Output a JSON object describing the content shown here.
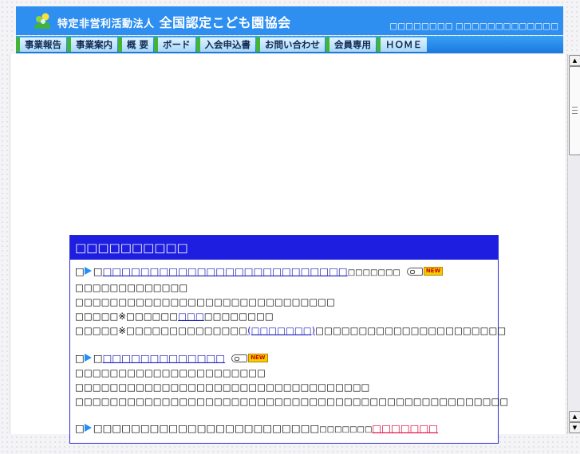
{
  "header": {
    "title_small": "特定非営利活動法人",
    "title_main": "全国認定こども園協会",
    "subtitle": "□□□□□□□□ □□□□□□□□□□□□□"
  },
  "nav": [
    {
      "label": "事業報告"
    },
    {
      "label": "事業案内"
    },
    {
      "label": "概 要"
    },
    {
      "label": "ボード"
    },
    {
      "label": "入会申込書"
    },
    {
      "label": "お問い合わせ"
    },
    {
      "label": "会員専用"
    },
    {
      "label": "ＨＯＭＥ"
    }
  ],
  "news": {
    "heading": "□□□□□□□□□□",
    "entries": [
      {
        "title_prefix": "□",
        "title_link": "□□□□□□□□□□□□□□□□□□□□□□□□□□",
        "title_suffix": "□□□□□□□",
        "badge": "NEW",
        "lines": [
          {
            "text": "□□□□□□□□□□□□□"
          },
          {
            "text": "□□□□□□□□□□□□□□□□□□□□□□□□□□□□□□"
          },
          {
            "pre": "□□□□□※□□□□□□",
            "link": "□□□",
            "post": "□□□□□□□□"
          },
          {
            "pre": "□□□□□※□□□□□□□□□□□□□□",
            "link": "(□□□□□□□)",
            "post": "□□□□□□□□□□□□□□□□□□□□□□"
          }
        ]
      },
      {
        "title_prefix": "□",
        "title_link": "□□□□□□□□□□□□□",
        "title_suffix": "",
        "badge": "NEW",
        "lines": [
          {
            "text": "□□□□□□□□□□□□□□□□□□□□□□"
          },
          {
            "text": "□□□□□□□□□□□□□□□□□□□□□□□□□□□□□□□□□□"
          },
          {
            "text": "□□□□□□□□□□□□□□□□□□□□□□□□□□□□□□□□□□□□□□□□□□□□□□□□□□"
          }
        ]
      },
      {
        "title_prefix": "□",
        "title_plain": "□□□□□□□□□□□□□□□□□□□□□□□□",
        "title_suffix": "□□□□□□□",
        "title_red": "□□□□□□□"
      }
    ]
  },
  "colors": {
    "header_bg": "#2e8ff0",
    "nav_accent": "#42b436",
    "news_header_bg": "#1e1ee0",
    "link": "#1a1ab8",
    "highlight_red": "#e2003c"
  }
}
